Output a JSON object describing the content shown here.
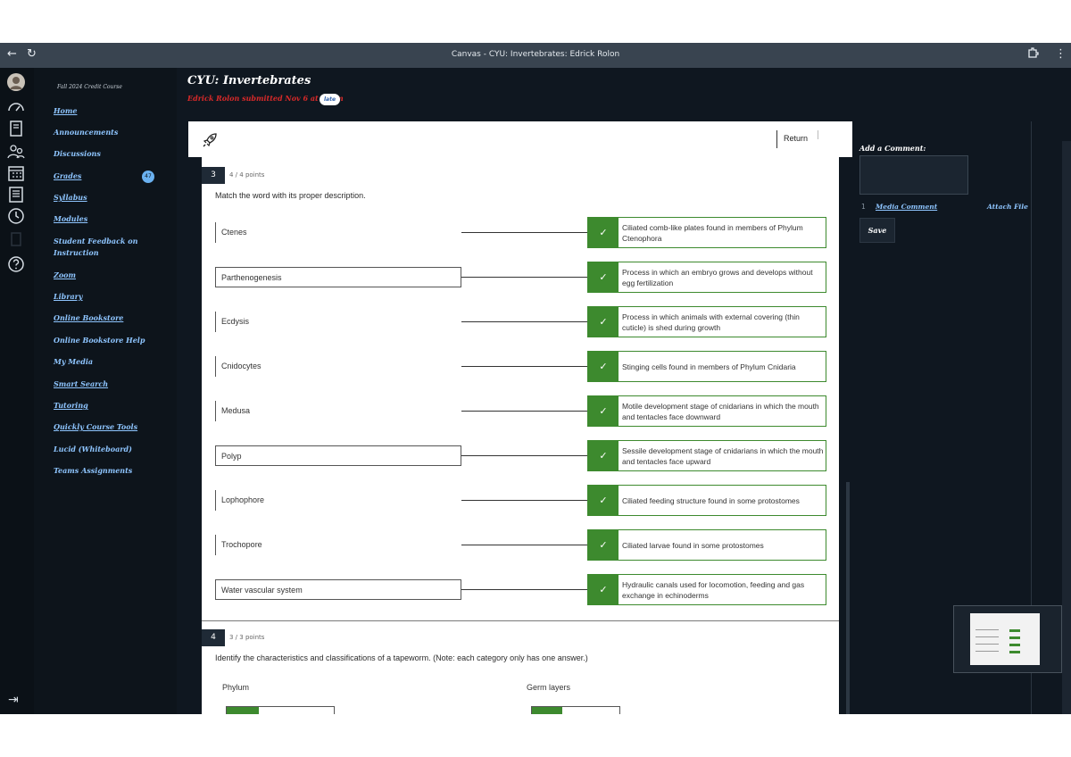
{
  "browser": {
    "back_glyph": "←",
    "reload_glyph": "↻",
    "title": "Canvas - CYU: Invertebrates: Edrick Rolon",
    "menu_glyph": "⋮"
  },
  "course_nav": {
    "term": "Fall 2024 Credit Course",
    "items": [
      {
        "label": "Home"
      },
      {
        "label": "Announcements"
      },
      {
        "label": "Discussions"
      },
      {
        "label": "Grades",
        "badge": "47"
      },
      {
        "label": "Syllabus"
      },
      {
        "label": "Modules"
      },
      {
        "label": "Student Feedback on Instruction"
      },
      {
        "label": "Zoom"
      },
      {
        "label": "Library"
      },
      {
        "label": "Online Bookstore"
      },
      {
        "label": "Online Bookstore Help"
      },
      {
        "label": "My Media"
      },
      {
        "label": "Smart Search"
      },
      {
        "label": "Tutoring"
      },
      {
        "label": "Quickly Course Tools"
      },
      {
        "label": "Lucid (Whiteboard)"
      },
      {
        "label": "Teams Assignments"
      }
    ]
  },
  "header": {
    "title": "CYU: Invertebrates",
    "submitted": "Edrick Rolon submitted Nov 6 at 11pm",
    "late_badge": "late"
  },
  "toolbar": {
    "return_label": "Return"
  },
  "question3": {
    "number": "3",
    "points": "4 / 4 points",
    "text": "Match the word with its proper description.",
    "check_glyph": "✓",
    "pairs": [
      {
        "term": "Ctenes",
        "description": "Ciliated comb-like plates found in members of Phylum Ctenophora",
        "style": "bar"
      },
      {
        "term": "Parthenogenesis",
        "description": "Process in which an embryo grows and develops without egg fertilization",
        "style": "boxed"
      },
      {
        "term": "Ecdysis",
        "description": "Process in which animals with external covering (thin cuticle) is shed during growth",
        "style": "bar"
      },
      {
        "term": "Cnidocytes",
        "description": "Stinging cells found in members of Phylum Cnidaria",
        "style": "bar"
      },
      {
        "term": "Medusa",
        "description": "Motile development stage of cnidarians in which the mouth and tentacles face downward",
        "style": "bar"
      },
      {
        "term": "Polyp",
        "description": "Sessile development stage of cnidarians in which the mouth and tentacles face upward",
        "style": "boxed"
      },
      {
        "term": "Lophophore",
        "description": "Ciliated feeding structure found in some protostomes",
        "style": "bar"
      },
      {
        "term": "Trochopore",
        "description": "Ciliated larvae found in some protostomes",
        "style": "bar"
      },
      {
        "term": "Water vascular system",
        "description": "Hydraulic canals used for locomotion, feeding and gas exchange in echinoderms",
        "style": "boxed"
      }
    ]
  },
  "question4": {
    "number": "4",
    "points": "3 / 3 points",
    "text": "Identify the characteristics and classifications of a tapeworm. (Note: each category only has one answer.)",
    "categories": [
      "Phylum",
      "Germ layers"
    ]
  },
  "comments": {
    "heading": "Add a Comment:",
    "media_num": "1",
    "media_comment": "Media Comment",
    "attach_file": "Attach File",
    "save_label": "Save"
  },
  "colors": {
    "correct": "#3d8a2e",
    "link": "#8ec5ff",
    "late": "#d62929"
  }
}
